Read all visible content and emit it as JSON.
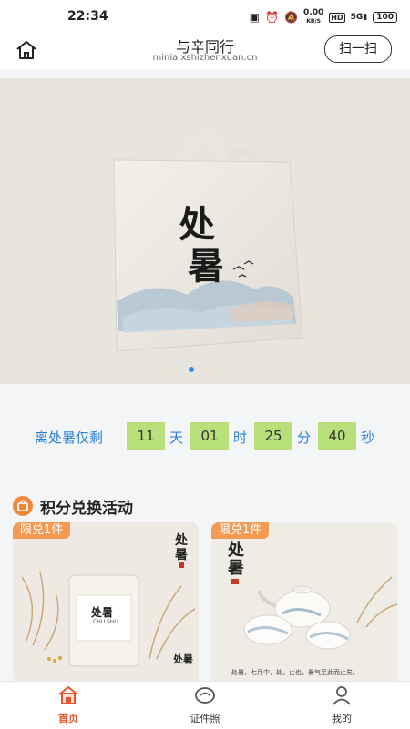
{
  "status_bar": {
    "time": "22:34",
    "speed_value": "0.00",
    "speed_unit": "KB/S",
    "hd": "HD",
    "signal": "5G",
    "battery": "100"
  },
  "header": {
    "title": "与辛同行",
    "subtitle": "minia.xshizhenxuan.cn",
    "scan_label": "扫一扫"
  },
  "banner": {
    "bag_text_line1": "处",
    "bag_text_line2": "暑",
    "active_dot": 0,
    "accent": "#2d8cf0"
  },
  "countdown": {
    "label": "离处暑仅剩",
    "days": "11",
    "days_unit": "天",
    "hours": "01",
    "hours_unit": "时",
    "minutes": "25",
    "minutes_unit": "分",
    "seconds": "40",
    "seconds_unit": "秒"
  },
  "section": {
    "title": "积分兑换活动",
    "icon": "gift-bag-icon"
  },
  "products": [
    {
      "badge": "限兑1件",
      "calligraphy": "处暑",
      "jar_label": "处暑",
      "pinyin": "CHU SHU",
      "corner_text": "处暑"
    },
    {
      "badge": "限兑1件",
      "calligraphy": "处暑",
      "caption": "处暑，七月中，处，止也，暑气至此而止矣。"
    }
  ],
  "tabbar": {
    "items": [
      {
        "label": "首页",
        "icon": "home-icon",
        "active": true
      },
      {
        "label": "证件照",
        "icon": "photo-id-icon",
        "active": false
      },
      {
        "label": "我的",
        "icon": "user-icon",
        "active": false
      }
    ],
    "active_color": "#e8542a"
  }
}
